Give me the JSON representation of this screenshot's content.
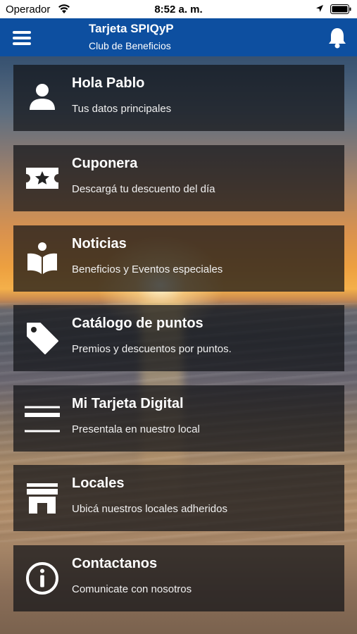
{
  "status_bar": {
    "carrier": "Operador",
    "time": "8:52 a. m.",
    "icons": [
      "wifi-icon",
      "location-arrow-icon",
      "battery-icon"
    ]
  },
  "header": {
    "title": "Tarjeta SPIQyP",
    "subtitle": "Club de Beneficios",
    "menu_icon": "hamburger-menu-icon",
    "notification_icon": "bell-icon",
    "color": "#0d4fa0"
  },
  "menu": [
    {
      "title": "Hola Pablo",
      "subtitle": "Tus datos principales",
      "icon": "user-icon"
    },
    {
      "title": "Cuponera",
      "subtitle": "Descargá tu descuento del día",
      "icon": "ticket-star-icon"
    },
    {
      "title": "Noticias",
      "subtitle": "Beneficios y Eventos especiales",
      "icon": "reader-book-icon"
    },
    {
      "title": "Catálogo de puntos",
      "subtitle": "Premios y descuentos por puntos.",
      "icon": "tag-icon"
    },
    {
      "title": "Mi Tarjeta Digital",
      "subtitle": "Presentala en nuestro local",
      "icon": "credit-card-icon"
    },
    {
      "title": "Locales",
      "subtitle": "Ubicá nuestros locales adheridos",
      "icon": "store-icon"
    },
    {
      "title": "Contactanos",
      "subtitle": "Comunicate con nosotros",
      "icon": "info-icon"
    }
  ]
}
